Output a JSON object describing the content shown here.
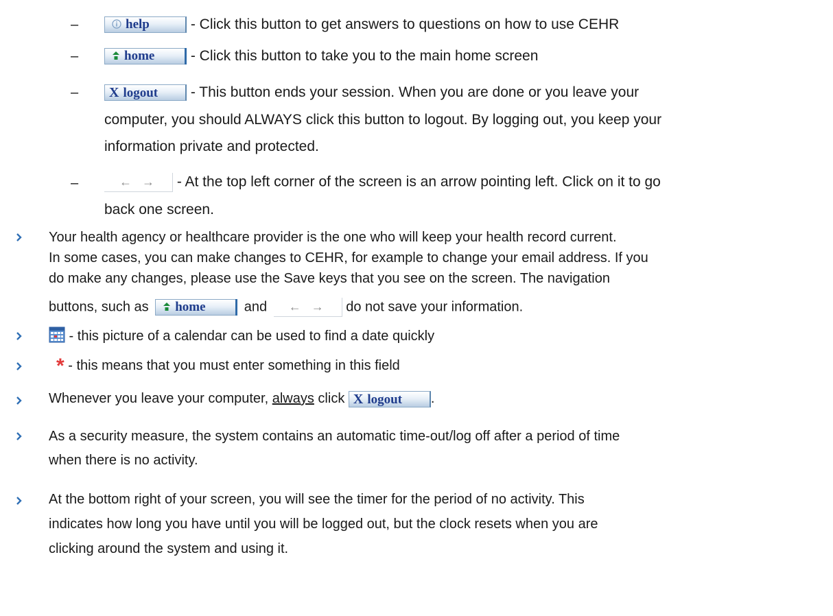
{
  "buttons": {
    "help_label": "help",
    "home_label": "home",
    "logout_label": "logout",
    "logout_icon": "X"
  },
  "items": {
    "help_desc": " - Click this button to get answers to questions on how to use CEHR",
    "home_desc": " - Click this button to take you to the main home screen",
    "logout_desc_1": " - This button ends your session.  When you are done or you leave your",
    "logout_desc_2": "computer, you should ALWAYS click this button to logout. By logging out, you keep your",
    "logout_desc_3": "information private and protected.",
    "arrows_desc_1": " - At the top left corner of the screen is an arrow pointing left.  Click on it to go",
    "arrows_desc_2": "back one screen.",
    "dash": "–"
  },
  "bullets": {
    "record_1": "Your health agency or healthcare provider is the one who will keep your health record current.",
    "record_2": "In some cases, you can make changes to CEHR, for example to change your email address. If you",
    "record_3": "do make any changes, please use the Save keys that you see on the screen. The navigation",
    "record_4a": "buttons, such as ",
    "record_4b": " and ",
    "record_4c": " do not save your information.",
    "calendar_desc": " - this picture of a calendar can be used to find a date quickly",
    "asterisk_symbol": "*",
    "asterisk_desc": " -   this means that you must enter something in this field",
    "leave_a": "Whenever you leave your computer, ",
    "leave_b": "always",
    "leave_c": " click ",
    "leave_d": ".",
    "timeout_1": "As a security measure, the system contains an automatic time-out/log off after a period of time",
    "timeout_2": "when there is no activity.",
    "timer_1": "At the bottom right of your screen, you will see the timer for the period of no activity. This",
    "timer_2": "indicates how long you have until you will be logged out, but the clock resets when you are",
    "timer_3": "clicking around the system and using it."
  },
  "icons": {
    "arrow_left": "←",
    "arrow_right": "→",
    "info_icon": "info-circle-icon",
    "home_icon": "house-arrow-icon",
    "calendar_icon": "calendar-icon",
    "bullet_icon": "chevron-right-icon"
  },
  "colors": {
    "bullet": "#2f6fb5",
    "button_text": "#1f3c8c",
    "asterisk": "#e23a3a",
    "home_icon": "#1a8a3a"
  }
}
